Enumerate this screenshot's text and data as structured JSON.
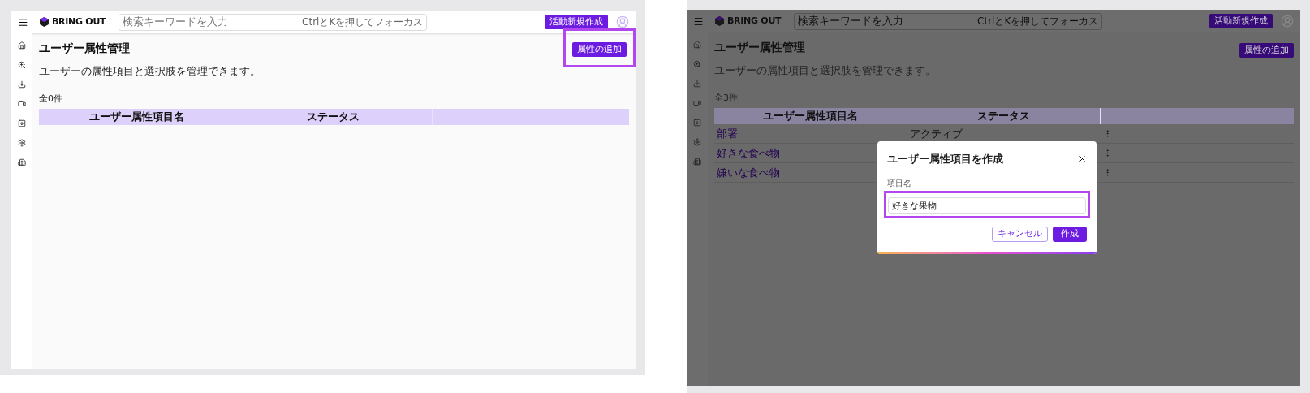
{
  "screens": [
    {
      "header": {
        "logo": "BRING OUT",
        "search_placeholder": "検索キーワードを入力",
        "search_hint": "CtrlとKを押してフォーカス",
        "create_button": "活動新規作成"
      },
      "page": {
        "title": "ユーザー属性管理",
        "description": "ユーザーの属性項目と選択肢を管理できます。",
        "add_button": {
          "label": "属性の追加",
          "highlighted": true
        },
        "count": "全0件"
      },
      "table": {
        "columns": [
          "ユーザー属性項目名",
          "ステータス"
        ]
      }
    },
    {
      "header": {
        "logo": "BRING OUT",
        "search_placeholder": "検索キーワードを入力",
        "search_hint": "CtrlとKを押してフォーカス",
        "create_button": "活動新規作成"
      },
      "page": {
        "title": "ユーザー属性管理",
        "description": "ユーザーの属性項目と選択肢を管理できます。",
        "add_button": {
          "label": "属性の追加",
          "highlighted": false
        },
        "count": "全3件"
      },
      "table": {
        "columns": [
          "ユーザー属性項目名",
          "ステータス"
        ],
        "rows": [
          {
            "name": "部署",
            "status": "アクティブ"
          },
          {
            "name": "好きな食べ物"
          },
          {
            "name": "嫌いな食べ物"
          }
        ]
      },
      "dialog": {
        "title": "ユーザー属性項目を作成",
        "field": {
          "label": "項目名",
          "value": "好きな果物",
          "highlighted": true
        },
        "cancel": "キャンセル",
        "submit": "作成"
      }
    }
  ]
}
